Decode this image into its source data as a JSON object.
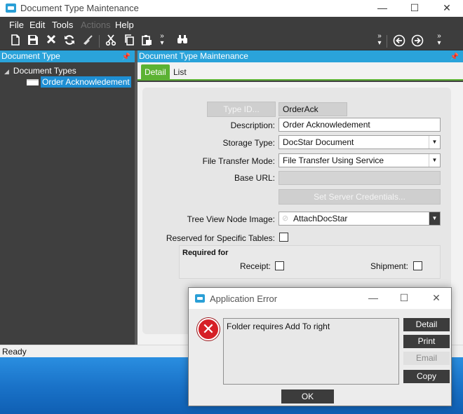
{
  "window": {
    "title": "Document Type Maintenance",
    "controls": {
      "minimize": "—",
      "maximize": "☐",
      "close": "✕"
    }
  },
  "menubar": {
    "items": [
      {
        "label": "File",
        "enabled": true
      },
      {
        "label": "Edit",
        "enabled": true
      },
      {
        "label": "Tools",
        "enabled": true
      },
      {
        "label": "Actions",
        "enabled": false
      },
      {
        "label": "Help",
        "enabled": true
      }
    ]
  },
  "toolbar": {
    "icons": [
      "new-icon",
      "save-icon",
      "delete-icon",
      "refresh-icon",
      "clear-icon",
      "cut-icon",
      "copy-icon",
      "paste-icon",
      "binoculars-icon",
      "back-icon",
      "forward-icon"
    ],
    "more_glyph": "»"
  },
  "left_panel": {
    "title": "Document Type",
    "tree": {
      "root": "Document Types",
      "children": [
        "Order Acknowledement"
      ]
    }
  },
  "right_panel": {
    "title": "Document Type Maintenance",
    "tabs": [
      {
        "label": "Detail",
        "active": true
      },
      {
        "label": "List",
        "active": false
      }
    ]
  },
  "form": {
    "type_id": {
      "button": "Type ID...",
      "value": "OrderAck"
    },
    "description": {
      "label": "Description:",
      "value": "Order Acknowledement"
    },
    "storage_type": {
      "label": "Storage Type:",
      "value": "DocStar Document"
    },
    "file_transfer_mode": {
      "label": "File Transfer Mode:",
      "value": "File Transfer Using Service"
    },
    "base_url": {
      "label": "Base URL:",
      "value": ""
    },
    "set_credentials_button": "Set Server Credentials...",
    "tree_view_node_image": {
      "label": "Tree View Node Image:",
      "value": "AttachDocStar"
    },
    "reserved": {
      "label": "Reserved for Specific Tables:",
      "checked": false
    },
    "required_for": {
      "title": "Required for",
      "receipt": {
        "label": "Receipt:",
        "checked": false
      },
      "shipment": {
        "label": "Shipment:",
        "checked": false
      }
    }
  },
  "status": {
    "text": "Ready"
  },
  "dialog": {
    "title": "Application Error",
    "message": "Folder requires Add To right",
    "buttons": [
      {
        "label": "Detail",
        "enabled": true
      },
      {
        "label": "Print",
        "enabled": true
      },
      {
        "label": "Email",
        "enabled": false
      },
      {
        "label": "Copy",
        "enabled": true
      }
    ],
    "ok_label": "OK",
    "error_glyph": "✕"
  },
  "colors": {
    "accent_blue": "#2aa3da",
    "tab_green": "#5cb233",
    "dark_bar": "#3d3d3d",
    "error_red": "#d61f26"
  }
}
